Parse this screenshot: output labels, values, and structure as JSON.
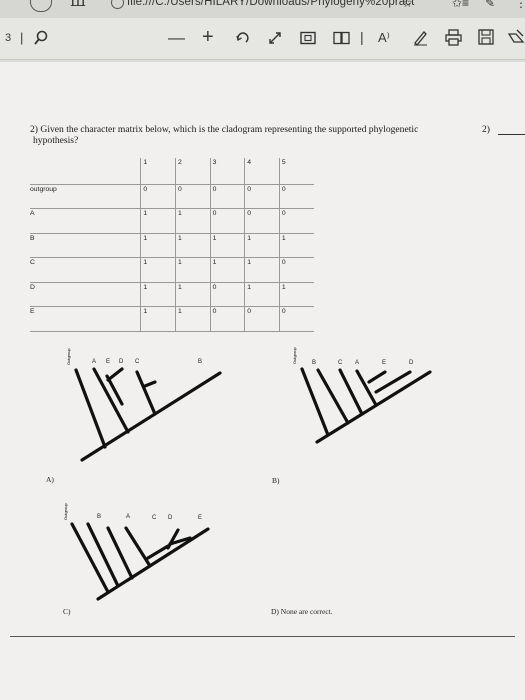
{
  "browser": {
    "url": "file:///C:/Users/HILARY/Downloads/Phylogeny%20pract",
    "url_visible": "file:///C:/Users/HILARY/Downloads/Phylogeny%20pract"
  },
  "toolbar": {
    "page_number": "3",
    "read_aloud_label": "A⁾"
  },
  "question": {
    "line1": "2) Given the character matrix below, which is the cladogram representing the supported phylogenetic",
    "line2": "hypothesis?",
    "number_right": "2)"
  },
  "matrix": {
    "columns": [
      "1",
      "2",
      "3",
      "4",
      "5"
    ],
    "rows": [
      {
        "label": "outgroup",
        "values": [
          "0",
          "0",
          "0",
          "0",
          "0"
        ]
      },
      {
        "label": "A",
        "values": [
          "1",
          "1",
          "0",
          "0",
          "0"
        ]
      },
      {
        "label": "B",
        "values": [
          "1",
          "1",
          "1",
          "1",
          "1"
        ]
      },
      {
        "label": "C",
        "values": [
          "1",
          "1",
          "1",
          "1",
          "0"
        ]
      },
      {
        "label": "D",
        "values": [
          "1",
          "1",
          "0",
          "1",
          "1"
        ]
      },
      {
        "label": "E",
        "values": [
          "1",
          "1",
          "0",
          "0",
          "0"
        ]
      }
    ]
  },
  "options": {
    "A": {
      "label": "A)",
      "taxa": [
        "A",
        "E",
        "D",
        "C",
        "B"
      ]
    },
    "B": {
      "label": "B)",
      "taxa": [
        "B",
        "C",
        "A",
        "E",
        "D"
      ]
    },
    "C": {
      "label": "C)",
      "taxa": [
        "B",
        "A",
        "C",
        "D",
        "E"
      ]
    },
    "D": {
      "label": "D) None are correct."
    }
  },
  "outgroup_label": "Outgroup"
}
